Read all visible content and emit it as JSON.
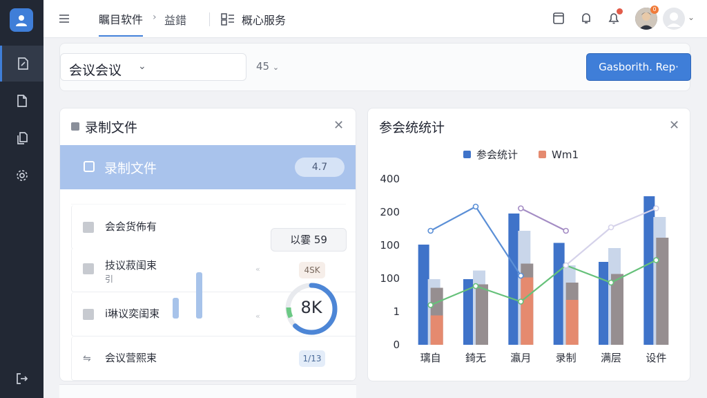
{
  "topbar": {
    "main_tab": "瞩目软件",
    "breadcrumb_sep": "›",
    "breadcrumb_sub": "益錯",
    "service_label": "概心服务",
    "notif_count": "0"
  },
  "filter": {
    "select_label": "会议会议",
    "mini_select": "45",
    "primary_button": "Gasborith. Rep·"
  },
  "left_panel": {
    "title": "录制文件",
    "highlight": {
      "label": "录制文件",
      "pill": "4.7"
    },
    "rows": [
      {
        "label": "会会货佈有",
        "sub": ""
      },
      {
        "label": "技议菽闺束",
        "sub": "引"
      },
      {
        "label": "i琳议奕闺束",
        "sub": ""
      },
      {
        "label": "会议营熙束",
        "sub": ""
      }
    ],
    "tooltip": "以霎 59",
    "tag_top": "4SK",
    "tag_bottom": "1/13",
    "gauge_value": "8K",
    "gauge_fraction": 0.62,
    "mini_bars": [
      0.4,
      0.9
    ]
  },
  "right_panel": {
    "title": "参会统统计"
  },
  "chart_data": {
    "type": "bar",
    "categories": [
      "璃自",
      "錡无",
      "瀛月",
      "录制",
      "满层",
      "设件"
    ],
    "y_tick_labels": [
      "0",
      "1",
      "100",
      "100",
      "200",
      "400"
    ],
    "legend": [
      {
        "name": "参会统计",
        "color": "#3f73c9"
      },
      {
        "name": "Wm1",
        "color": "#e58a6f"
      }
    ],
    "series": [
      {
        "name": "参会统计",
        "color": "#3f73c9",
        "values": [
          290,
          190,
          380,
          295,
          240,
          430
        ]
      },
      {
        "name": "",
        "color": "#c9d6ea",
        "values": [
          190,
          215,
          330,
          230,
          280,
          370
        ]
      },
      {
        "name": "",
        "color": "#968e90",
        "values": [
          165,
          175,
          235,
          180,
          205,
          310
        ]
      },
      {
        "name": "Wm1",
        "color": "#e58a6f",
        "values": [
          85,
          0,
          195,
          130,
          0,
          0
        ]
      }
    ],
    "lines": [
      {
        "color": "#5b8fd6",
        "values": [
          330,
          400,
          200,
          null,
          null,
          null
        ]
      },
      {
        "color": "#66c17a",
        "values": [
          115,
          170,
          125,
          230,
          180,
          245
        ]
      },
      {
        "color": "#a48cc4",
        "values": [
          null,
          null,
          395,
          330,
          null,
          null
        ]
      },
      {
        "color": "#d5d2ea",
        "values": [
          null,
          null,
          null,
          230,
          340,
          395
        ]
      }
    ],
    "ylim": [
      0,
      480
    ]
  }
}
